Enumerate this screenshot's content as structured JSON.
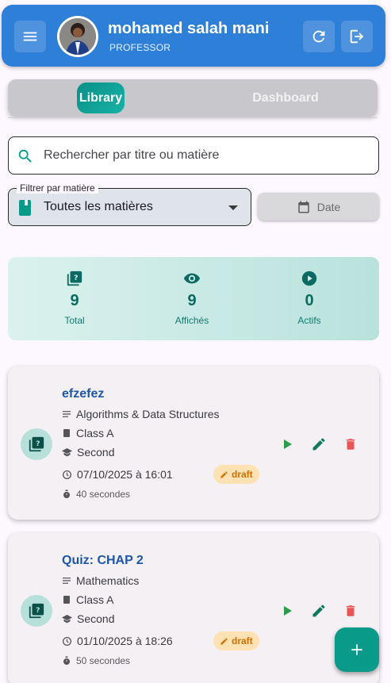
{
  "app_bar": {
    "user_name": "mohamed salah mani",
    "user_role": "PROFESSOR"
  },
  "tabs": [
    {
      "label": "Library",
      "active": true
    },
    {
      "label": "Dashboard",
      "active": false
    }
  ],
  "search": {
    "placeholder": "Rechercher par titre ou matière"
  },
  "filter": {
    "label": "Filtrer par matière",
    "selected": "Toutes les matières"
  },
  "date_button": {
    "label": "Date"
  },
  "stats": [
    {
      "value": "9",
      "label": "Total",
      "icon": "quiz-icon"
    },
    {
      "value": "9",
      "label": "Affichés",
      "icon": "eye-icon"
    },
    {
      "value": "0",
      "label": "Actifs",
      "icon": "play-circle-icon"
    }
  ],
  "quizzes": [
    {
      "title": "efzefez",
      "subject": "Algorithms & Data Structures",
      "class": "Class A",
      "level": "Second",
      "datetime": "07/10/2025 à 16:01",
      "duration": "40 secondes",
      "status": "draft"
    },
    {
      "title": "Quiz: CHAP 2",
      "subject": "Mathematics",
      "class": "Class A",
      "level": "Second",
      "datetime": "01/10/2025 à 18:26",
      "duration": "50 secondes",
      "status": "draft"
    }
  ],
  "colors": {
    "app_bar": "#2e7fd8",
    "accent": "#0a9a8a",
    "title": "#1e56a8",
    "play": "#2e9d4b",
    "edit": "#0b7a5f",
    "delete": "#e95454",
    "draft_bg": "#ffe2b3",
    "draft_fg": "#d56f00"
  }
}
